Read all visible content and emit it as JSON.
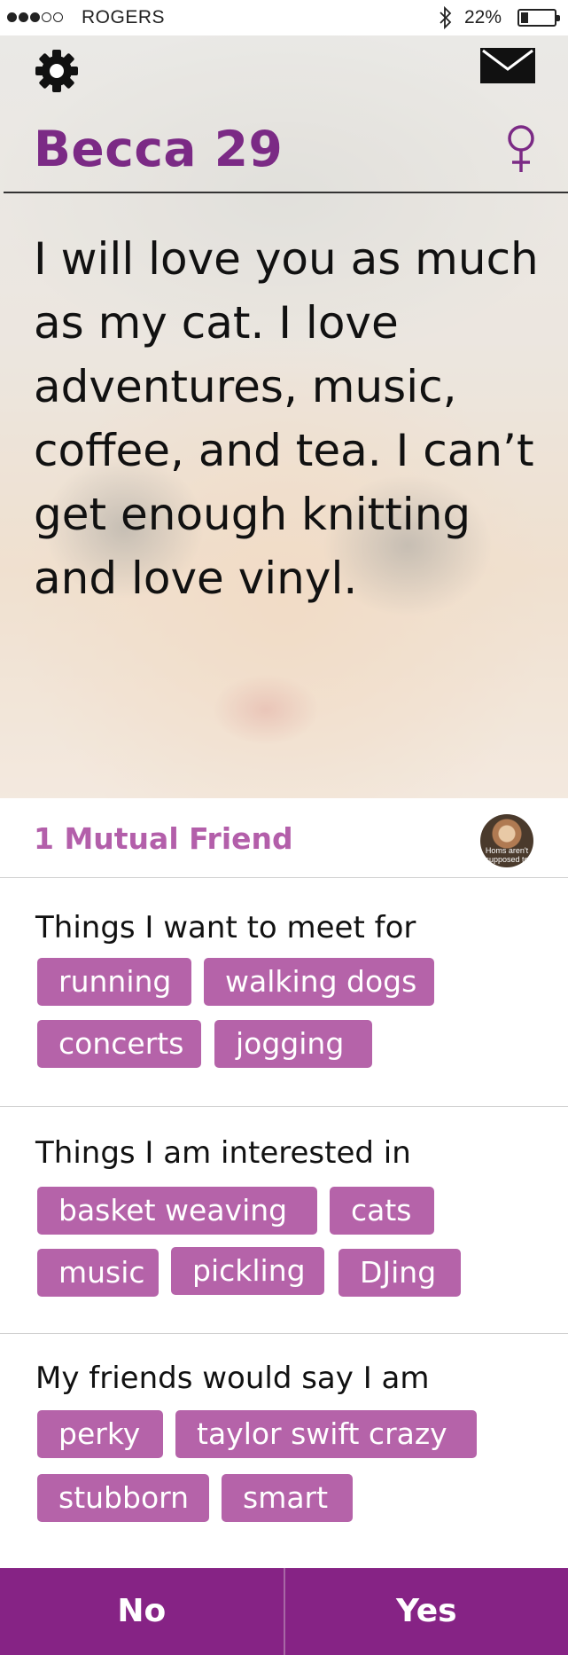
{
  "status_bar": {
    "signal_dots": [
      true,
      true,
      true,
      false,
      false
    ],
    "carrier": "ROGERS",
    "battery_percent": "22%",
    "battery_level": 0.22
  },
  "header": {
    "settings_icon": "gear-icon",
    "messages_icon": "mail-icon",
    "name": "Becca  29",
    "gender_icon": "female-symbol-icon"
  },
  "bio": "I will love you as much as my cat. I love adventures, music, coffee, and tea. I can’t get enough knitting and love vinyl.",
  "mutual": {
    "label": "1 Mutual Friend",
    "avatar_caption": "Homs aren't supposed to"
  },
  "sections": [
    {
      "title": "Things I want to meet for",
      "tags": [
        "running",
        "walking dogs",
        "concerts",
        "jogging"
      ]
    },
    {
      "title": "Things I am interested in",
      "tags": [
        "basket weaving",
        "cats",
        "music",
        "pickling",
        "DJing"
      ]
    },
    {
      "title": "My friends would say I am",
      "tags": [
        "perky",
        "taylor swift crazy",
        "stubborn",
        "smart"
      ]
    }
  ],
  "actions": {
    "no": "No",
    "yes": "Yes"
  },
  "colors": {
    "brand_purple": "#862385",
    "tag_purple": "#b563a9",
    "name_purple": "#7b2a85"
  }
}
